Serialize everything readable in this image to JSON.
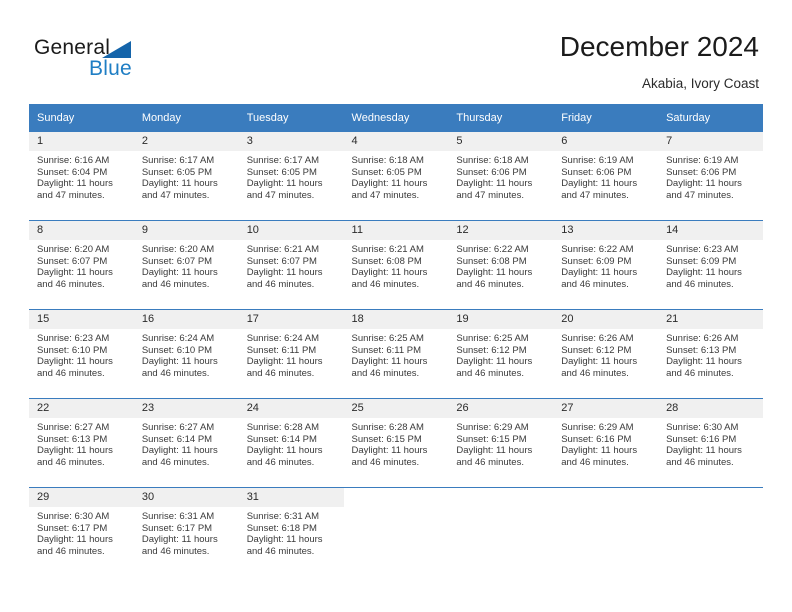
{
  "brand": {
    "name_part1": "General",
    "name_part2": "Blue",
    "triangle_color": "#1464aa",
    "blue_color": "#1f7ec4"
  },
  "header": {
    "title": "December 2024",
    "subtitle": "Akabia, Ivory Coast"
  },
  "theme": {
    "header_bg": "#3a7cbe",
    "daynum_bg": "#f0f0f0",
    "grid_line": "#3a7cbe",
    "text": "#3a3a3a"
  },
  "calendar": {
    "weekday_headers": [
      "Sunday",
      "Monday",
      "Tuesday",
      "Wednesday",
      "Thursday",
      "Friday",
      "Saturday"
    ],
    "weeks": [
      [
        {
          "day": "1",
          "sunrise": "Sunrise: 6:16 AM",
          "sunset": "Sunset: 6:04 PM",
          "daylight_line1": "Daylight: 11 hours",
          "daylight_line2": "and 47 minutes."
        },
        {
          "day": "2",
          "sunrise": "Sunrise: 6:17 AM",
          "sunset": "Sunset: 6:05 PM",
          "daylight_line1": "Daylight: 11 hours",
          "daylight_line2": "and 47 minutes."
        },
        {
          "day": "3",
          "sunrise": "Sunrise: 6:17 AM",
          "sunset": "Sunset: 6:05 PM",
          "daylight_line1": "Daylight: 11 hours",
          "daylight_line2": "and 47 minutes."
        },
        {
          "day": "4",
          "sunrise": "Sunrise: 6:18 AM",
          "sunset": "Sunset: 6:05 PM",
          "daylight_line1": "Daylight: 11 hours",
          "daylight_line2": "and 47 minutes."
        },
        {
          "day": "5",
          "sunrise": "Sunrise: 6:18 AM",
          "sunset": "Sunset: 6:06 PM",
          "daylight_line1": "Daylight: 11 hours",
          "daylight_line2": "and 47 minutes."
        },
        {
          "day": "6",
          "sunrise": "Sunrise: 6:19 AM",
          "sunset": "Sunset: 6:06 PM",
          "daylight_line1": "Daylight: 11 hours",
          "daylight_line2": "and 47 minutes."
        },
        {
          "day": "7",
          "sunrise": "Sunrise: 6:19 AM",
          "sunset": "Sunset: 6:06 PM",
          "daylight_line1": "Daylight: 11 hours",
          "daylight_line2": "and 47 minutes."
        }
      ],
      [
        {
          "day": "8",
          "sunrise": "Sunrise: 6:20 AM",
          "sunset": "Sunset: 6:07 PM",
          "daylight_line1": "Daylight: 11 hours",
          "daylight_line2": "and 46 minutes."
        },
        {
          "day": "9",
          "sunrise": "Sunrise: 6:20 AM",
          "sunset": "Sunset: 6:07 PM",
          "daylight_line1": "Daylight: 11 hours",
          "daylight_line2": "and 46 minutes."
        },
        {
          "day": "10",
          "sunrise": "Sunrise: 6:21 AM",
          "sunset": "Sunset: 6:07 PM",
          "daylight_line1": "Daylight: 11 hours",
          "daylight_line2": "and 46 minutes."
        },
        {
          "day": "11",
          "sunrise": "Sunrise: 6:21 AM",
          "sunset": "Sunset: 6:08 PM",
          "daylight_line1": "Daylight: 11 hours",
          "daylight_line2": "and 46 minutes."
        },
        {
          "day": "12",
          "sunrise": "Sunrise: 6:22 AM",
          "sunset": "Sunset: 6:08 PM",
          "daylight_line1": "Daylight: 11 hours",
          "daylight_line2": "and 46 minutes."
        },
        {
          "day": "13",
          "sunrise": "Sunrise: 6:22 AM",
          "sunset": "Sunset: 6:09 PM",
          "daylight_line1": "Daylight: 11 hours",
          "daylight_line2": "and 46 minutes."
        },
        {
          "day": "14",
          "sunrise": "Sunrise: 6:23 AM",
          "sunset": "Sunset: 6:09 PM",
          "daylight_line1": "Daylight: 11 hours",
          "daylight_line2": "and 46 minutes."
        }
      ],
      [
        {
          "day": "15",
          "sunrise": "Sunrise: 6:23 AM",
          "sunset": "Sunset: 6:10 PM",
          "daylight_line1": "Daylight: 11 hours",
          "daylight_line2": "and 46 minutes."
        },
        {
          "day": "16",
          "sunrise": "Sunrise: 6:24 AM",
          "sunset": "Sunset: 6:10 PM",
          "daylight_line1": "Daylight: 11 hours",
          "daylight_line2": "and 46 minutes."
        },
        {
          "day": "17",
          "sunrise": "Sunrise: 6:24 AM",
          "sunset": "Sunset: 6:11 PM",
          "daylight_line1": "Daylight: 11 hours",
          "daylight_line2": "and 46 minutes."
        },
        {
          "day": "18",
          "sunrise": "Sunrise: 6:25 AM",
          "sunset": "Sunset: 6:11 PM",
          "daylight_line1": "Daylight: 11 hours",
          "daylight_line2": "and 46 minutes."
        },
        {
          "day": "19",
          "sunrise": "Sunrise: 6:25 AM",
          "sunset": "Sunset: 6:12 PM",
          "daylight_line1": "Daylight: 11 hours",
          "daylight_line2": "and 46 minutes."
        },
        {
          "day": "20",
          "sunrise": "Sunrise: 6:26 AM",
          "sunset": "Sunset: 6:12 PM",
          "daylight_line1": "Daylight: 11 hours",
          "daylight_line2": "and 46 minutes."
        },
        {
          "day": "21",
          "sunrise": "Sunrise: 6:26 AM",
          "sunset": "Sunset: 6:13 PM",
          "daylight_line1": "Daylight: 11 hours",
          "daylight_line2": "and 46 minutes."
        }
      ],
      [
        {
          "day": "22",
          "sunrise": "Sunrise: 6:27 AM",
          "sunset": "Sunset: 6:13 PM",
          "daylight_line1": "Daylight: 11 hours",
          "daylight_line2": "and 46 minutes."
        },
        {
          "day": "23",
          "sunrise": "Sunrise: 6:27 AM",
          "sunset": "Sunset: 6:14 PM",
          "daylight_line1": "Daylight: 11 hours",
          "daylight_line2": "and 46 minutes."
        },
        {
          "day": "24",
          "sunrise": "Sunrise: 6:28 AM",
          "sunset": "Sunset: 6:14 PM",
          "daylight_line1": "Daylight: 11 hours",
          "daylight_line2": "and 46 minutes."
        },
        {
          "day": "25",
          "sunrise": "Sunrise: 6:28 AM",
          "sunset": "Sunset: 6:15 PM",
          "daylight_line1": "Daylight: 11 hours",
          "daylight_line2": "and 46 minutes."
        },
        {
          "day": "26",
          "sunrise": "Sunrise: 6:29 AM",
          "sunset": "Sunset: 6:15 PM",
          "daylight_line1": "Daylight: 11 hours",
          "daylight_line2": "and 46 minutes."
        },
        {
          "day": "27",
          "sunrise": "Sunrise: 6:29 AM",
          "sunset": "Sunset: 6:16 PM",
          "daylight_line1": "Daylight: 11 hours",
          "daylight_line2": "and 46 minutes."
        },
        {
          "day": "28",
          "sunrise": "Sunrise: 6:30 AM",
          "sunset": "Sunset: 6:16 PM",
          "daylight_line1": "Daylight: 11 hours",
          "daylight_line2": "and 46 minutes."
        }
      ],
      [
        {
          "day": "29",
          "sunrise": "Sunrise: 6:30 AM",
          "sunset": "Sunset: 6:17 PM",
          "daylight_line1": "Daylight: 11 hours",
          "daylight_line2": "and 46 minutes."
        },
        {
          "day": "30",
          "sunrise": "Sunrise: 6:31 AM",
          "sunset": "Sunset: 6:17 PM",
          "daylight_line1": "Daylight: 11 hours",
          "daylight_line2": "and 46 minutes."
        },
        {
          "day": "31",
          "sunrise": "Sunrise: 6:31 AM",
          "sunset": "Sunset: 6:18 PM",
          "daylight_line1": "Daylight: 11 hours",
          "daylight_line2": "and 46 minutes."
        },
        {
          "day": "",
          "sunrise": "",
          "sunset": "",
          "daylight_line1": "",
          "daylight_line2": ""
        },
        {
          "day": "",
          "sunrise": "",
          "sunset": "",
          "daylight_line1": "",
          "daylight_line2": ""
        },
        {
          "day": "",
          "sunrise": "",
          "sunset": "",
          "daylight_line1": "",
          "daylight_line2": ""
        },
        {
          "day": "",
          "sunrise": "",
          "sunset": "",
          "daylight_line1": "",
          "daylight_line2": ""
        }
      ]
    ]
  }
}
